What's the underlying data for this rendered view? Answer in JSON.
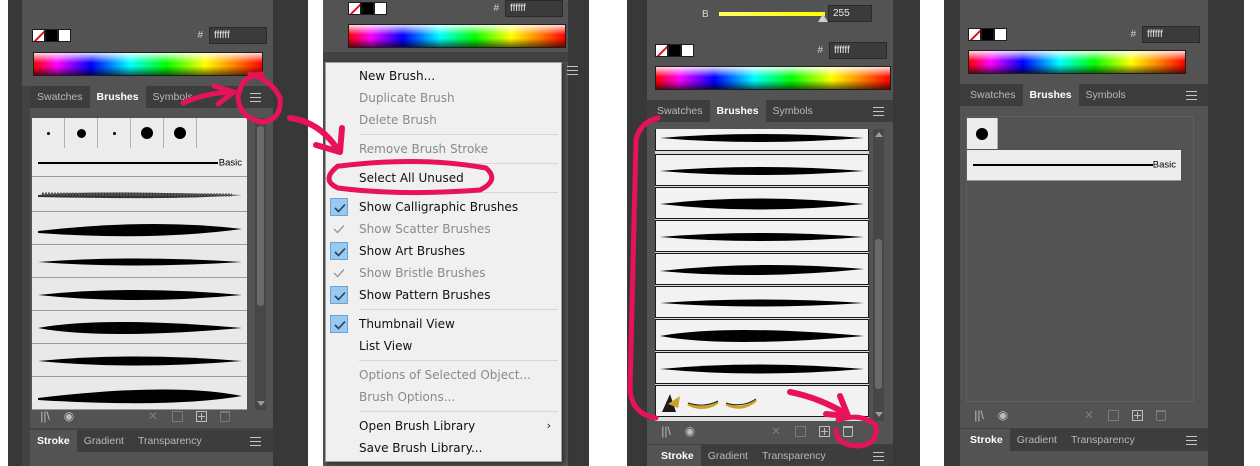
{
  "colors": {
    "accent_pink": "#e8125a",
    "panel": "#535353",
    "tab_bar": "#3d3d3d",
    "menu_bg": "#f0f0f0",
    "check_blue": "#99c9ef"
  },
  "color_panel": {
    "hex_symbol": "#",
    "hex_value": "ffffff",
    "slider_label": "B",
    "slider_value": "255"
  },
  "tabs": {
    "swatches": "Swatches",
    "brushes": "Brushes",
    "symbols": "Symbols"
  },
  "bottom_tabs": {
    "stroke": "Stroke",
    "gradient": "Gradient",
    "transparency": "Transparency"
  },
  "brushes": {
    "basic_label": "Basic"
  },
  "icons": [
    "library-icon",
    "brush-options-icon",
    "remove-stroke-icon",
    "brush-options-box-icon",
    "new-brush-icon",
    "trash-icon",
    "panel-menu-icon"
  ],
  "context_menu": {
    "items": [
      {
        "label": "New Brush...",
        "enabled": true
      },
      {
        "label": "Duplicate Brush",
        "enabled": false
      },
      {
        "label": "Delete Brush",
        "enabled": false
      },
      {
        "label": "Remove Brush Stroke",
        "enabled": false
      },
      {
        "label": "Select All Unused",
        "enabled": true
      },
      {
        "label": "Show Calligraphic Brushes",
        "enabled": true,
        "checked": true
      },
      {
        "label": "Show Scatter Brushes",
        "enabled": false,
        "checked": true
      },
      {
        "label": "Show Art Brushes",
        "enabled": true,
        "checked": true
      },
      {
        "label": "Show Bristle Brushes",
        "enabled": false,
        "checked": true
      },
      {
        "label": "Show Pattern Brushes",
        "enabled": true,
        "checked": true
      },
      {
        "label": "Thumbnail View",
        "enabled": true,
        "checked": true
      },
      {
        "label": "List View",
        "enabled": true
      },
      {
        "label": "Options of Selected Object...",
        "enabled": false
      },
      {
        "label": "Brush Options...",
        "enabled": false
      },
      {
        "label": "Open Brush Library",
        "enabled": true,
        "submenu": true
      },
      {
        "label": "Save Brush Library...",
        "enabled": true
      }
    ]
  }
}
